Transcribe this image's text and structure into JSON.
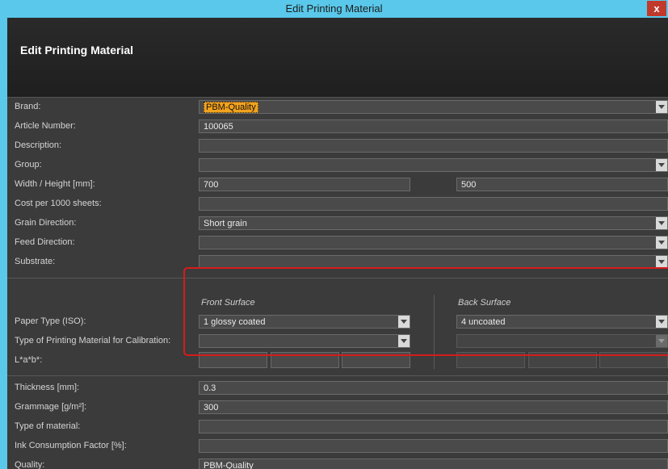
{
  "window": {
    "title": "Edit Printing Material",
    "close_glyph": "x"
  },
  "header": {
    "title": "Edit Printing Material"
  },
  "fields": {
    "brand": {
      "label": "Brand:",
      "value": "PBM-Quality"
    },
    "article_number": {
      "label": "Article Number:",
      "value": "100065"
    },
    "description": {
      "label": "Description:",
      "value": ""
    },
    "group": {
      "label": "Group:",
      "value": ""
    },
    "width_height": {
      "label": "Width / Height [mm]:",
      "width": "700",
      "height": "500"
    },
    "cost": {
      "label": "Cost per 1000 sheets:",
      "value": ""
    },
    "grain_direction": {
      "label": "Grain Direction:",
      "value": "Short grain"
    },
    "feed_direction": {
      "label": "Feed Direction:",
      "value": ""
    },
    "substrate": {
      "label": "Substrate:",
      "value": ""
    }
  },
  "surfaces": {
    "front_label": "Front Surface",
    "back_label": "Back Surface",
    "paper_type": {
      "label": "Paper Type (ISO):",
      "front": "1 glossy coated",
      "back": "4 uncoated"
    },
    "calibration": {
      "label": "Type of Printing Material for Calibration:",
      "front": "",
      "back": ""
    },
    "lab": {
      "label": "L*a*b*:"
    }
  },
  "lower": {
    "thickness": {
      "label": "Thickness [mm]:",
      "value": "0.3"
    },
    "grammage": {
      "label": "Grammage [g/m²]:",
      "value": "300"
    },
    "material_type": {
      "label": "Type of material:",
      "value": ""
    },
    "ink_factor": {
      "label": "Ink Consumption Factor [%]:",
      "value": ""
    },
    "quality": {
      "label": "Quality:",
      "value": "PBM-Quality"
    }
  }
}
